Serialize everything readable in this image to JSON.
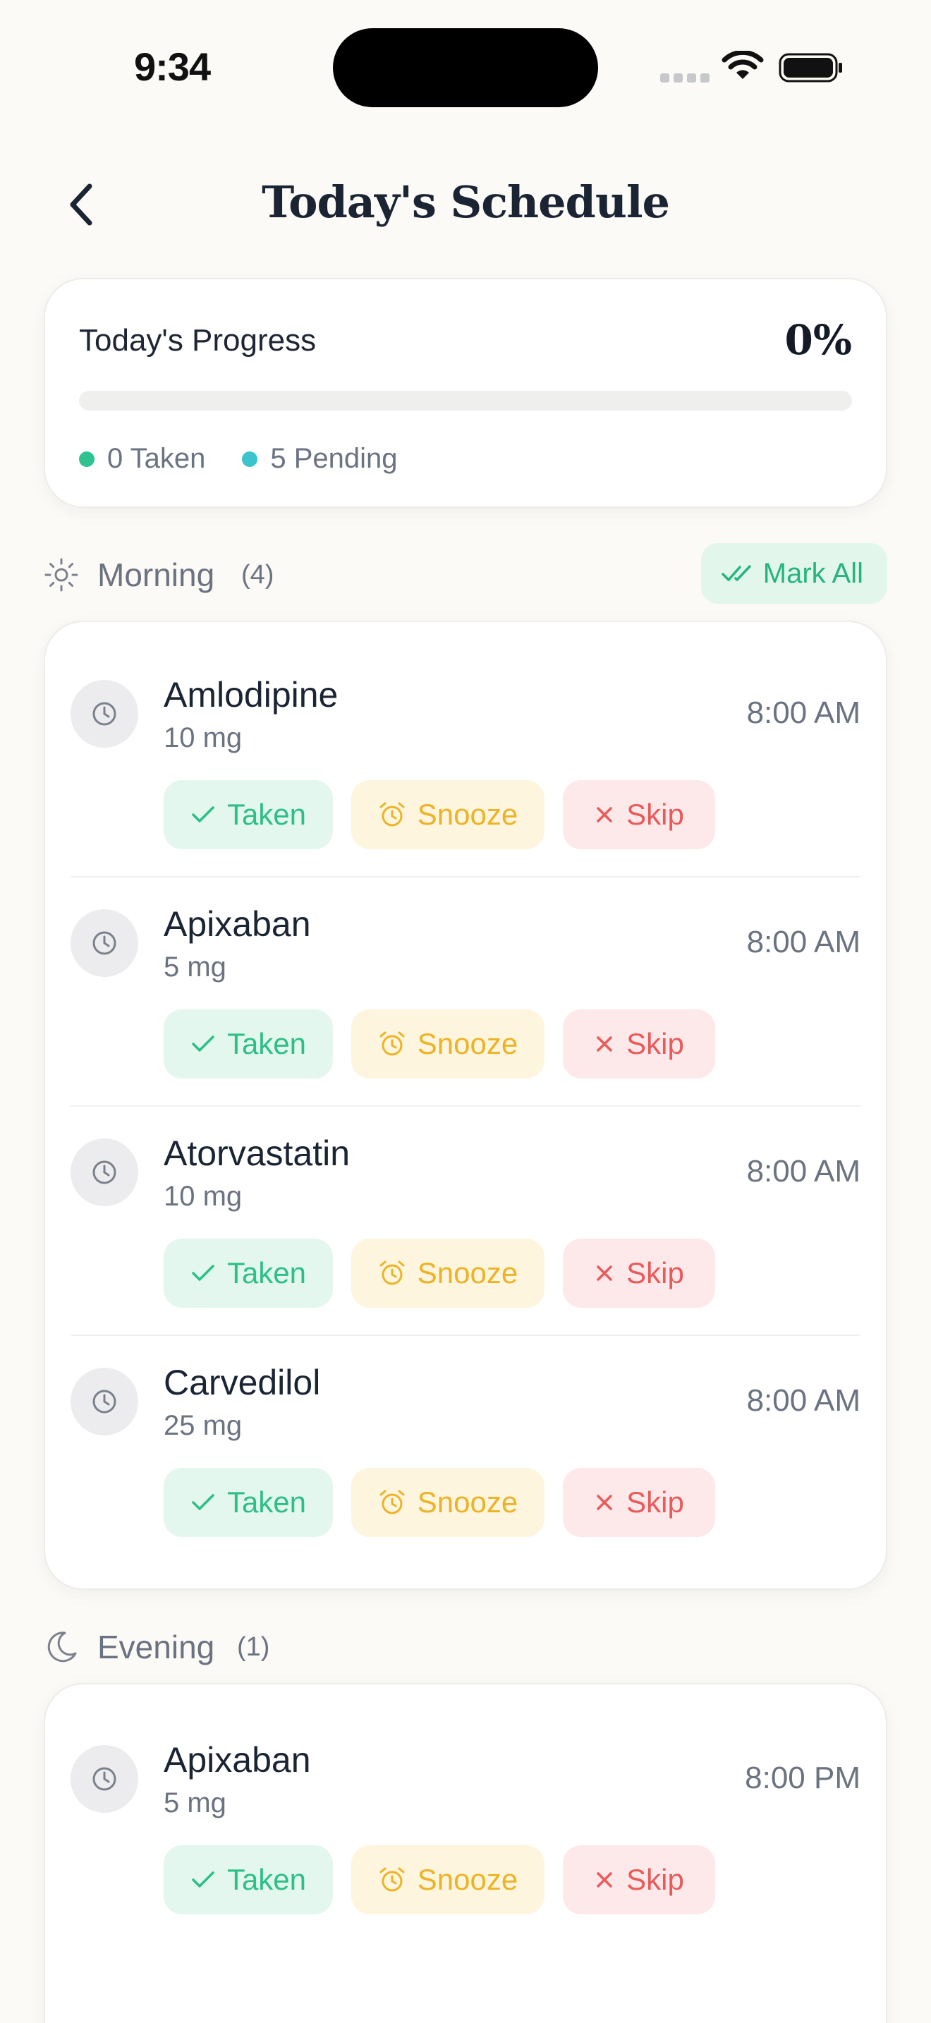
{
  "status_bar": {
    "time": "9:34"
  },
  "header": {
    "title": "Today's Schedule"
  },
  "progress": {
    "title": "Today's Progress",
    "percent_label": "0%",
    "fraction": 0,
    "taken_label": "0 Taken",
    "pending_label": "5 Pending",
    "colors": {
      "taken": "#2FC48F",
      "pending": "#3BC3CE"
    }
  },
  "sections": {
    "morning": {
      "title": "Morning",
      "count": "(4)",
      "icon": "sun-icon",
      "mark_all_label": "Mark All",
      "items": [
        {
          "name": "Amlodipine",
          "dose": "10 mg",
          "time": "8:00 AM"
        },
        {
          "name": "Apixaban",
          "dose": "5 mg",
          "time": "8:00 AM"
        },
        {
          "name": "Atorvastatin",
          "dose": "10 mg",
          "time": "8:00 AM"
        },
        {
          "name": "Carvedilol",
          "dose": "25 mg",
          "time": "8:00 AM"
        }
      ]
    },
    "evening": {
      "title": "Evening",
      "count": "(1)",
      "icon": "moon-icon",
      "items": [
        {
          "name": "Apixaban",
          "dose": "5 mg",
          "time": "8:00 PM"
        }
      ]
    }
  },
  "actions": {
    "taken": "Taken",
    "snooze": "Snooze",
    "skip": "Skip"
  },
  "colors": {
    "accent_green": "#2CBF86",
    "snooze_yellow": "#EDB326",
    "skip_red": "#EA5A5A",
    "background": "#FBFAF7"
  }
}
